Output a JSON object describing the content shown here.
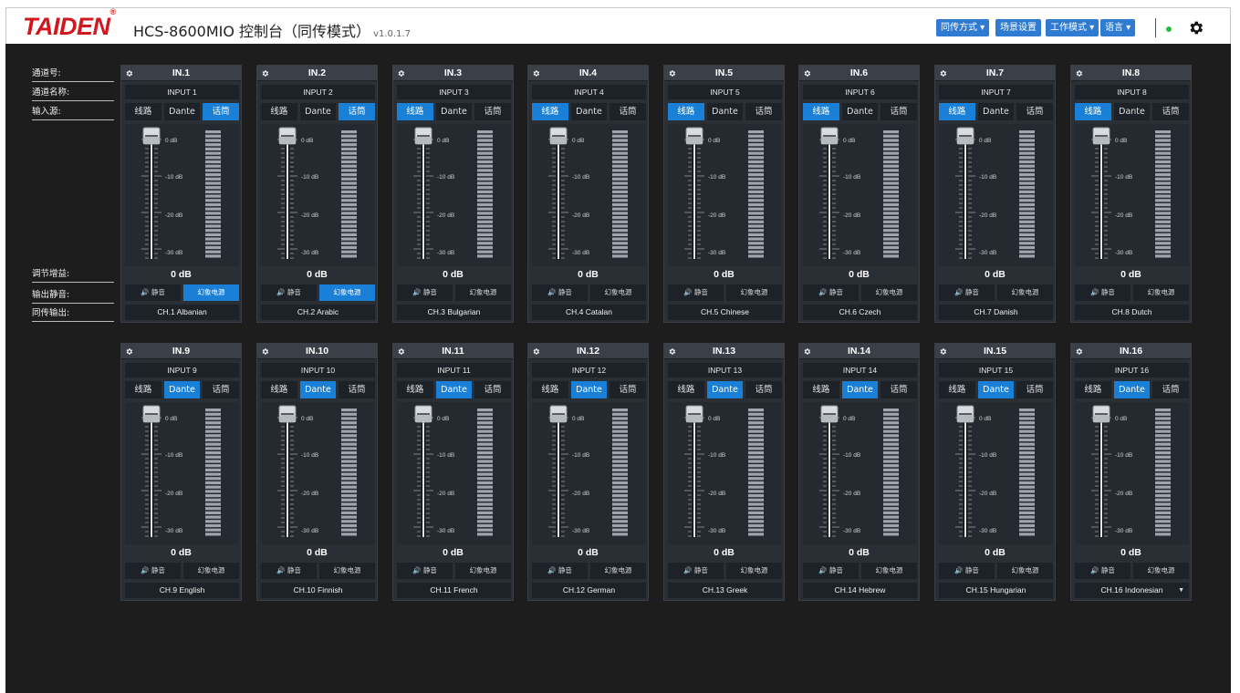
{
  "header": {
    "logo": "TAIDEN",
    "logo_mark": "®",
    "title": "HCS-8600MIO 控制台（同传模式）",
    "version": "v1.0.1.7",
    "menus": [
      "同传方式 ▾",
      "场景设置",
      "工作模式 ▾",
      "语言 ▾"
    ],
    "status_color": "#1fbf3c",
    "settings_icon": "gear-icon"
  },
  "row_labels": {
    "channel_num": "通道号:",
    "channel_name": "通道名称:",
    "input_source": "输入源:",
    "adjust_gain": "调节增益:",
    "output_mute": "输出静音:",
    "interp_output": "同传输出:"
  },
  "sources": [
    "线路",
    "Dante",
    "话筒"
  ],
  "mute_label": "🔊 静音",
  "phantom_label": "幻象电源",
  "scale": [
    "0 dB",
    "-10 dB",
    "-20 dB",
    "-30 dB"
  ],
  "accent_color": "#1a7fd6",
  "channels": [
    {
      "num": "IN.1",
      "name": "INPUT 1",
      "source": "话筒",
      "gain": "0 dB",
      "fader_level": 1.0,
      "mute": false,
      "phantom": true,
      "output": "CH.1 Albanian"
    },
    {
      "num": "IN.2",
      "name": "INPUT 2",
      "source": "话筒",
      "gain": "0 dB",
      "fader_level": 1.0,
      "mute": false,
      "phantom": true,
      "output": "CH.2 Arabic"
    },
    {
      "num": "IN.3",
      "name": "INPUT 3",
      "source": "线路",
      "gain": "0 dB",
      "fader_level": 1.0,
      "mute": false,
      "phantom": false,
      "output": "CH.3 Bulgarian"
    },
    {
      "num": "IN.4",
      "name": "INPUT 4",
      "source": "线路",
      "gain": "0 dB",
      "fader_level": 1.0,
      "mute": false,
      "phantom": false,
      "output": "CH.4 Catalan"
    },
    {
      "num": "IN.5",
      "name": "INPUT 5",
      "source": "线路",
      "gain": "0 dB",
      "fader_level": 1.0,
      "mute": false,
      "phantom": false,
      "output": "CH.5 Chinese"
    },
    {
      "num": "IN.6",
      "name": "INPUT 6",
      "source": "线路",
      "gain": "0 dB",
      "fader_level": 1.0,
      "mute": false,
      "phantom": false,
      "output": "CH.6 Czech"
    },
    {
      "num": "IN.7",
      "name": "INPUT 7",
      "source": "线路",
      "gain": "0 dB",
      "fader_level": 1.0,
      "mute": false,
      "phantom": false,
      "output": "CH.7 Danish"
    },
    {
      "num": "IN.8",
      "name": "INPUT 8",
      "source": "线路",
      "gain": "0 dB",
      "fader_level": 1.0,
      "mute": false,
      "phantom": false,
      "output": "CH.8 Dutch"
    },
    {
      "num": "IN.9",
      "name": "INPUT 9",
      "source": "Dante",
      "gain": "0 dB",
      "fader_level": 1.0,
      "mute": false,
      "phantom": false,
      "output": "CH.9 English"
    },
    {
      "num": "IN.10",
      "name": "INPUT 10",
      "source": "Dante",
      "gain": "0 dB",
      "fader_level": 1.0,
      "mute": false,
      "phantom": false,
      "output": "CH.10 Finnish"
    },
    {
      "num": "IN.11",
      "name": "INPUT 11",
      "source": "Dante",
      "gain": "0 dB",
      "fader_level": 1.0,
      "mute": false,
      "phantom": false,
      "output": "CH.11 French"
    },
    {
      "num": "IN.12",
      "name": "INPUT 12",
      "source": "Dante",
      "gain": "0 dB",
      "fader_level": 1.0,
      "mute": false,
      "phantom": false,
      "output": "CH.12 German"
    },
    {
      "num": "IN.13",
      "name": "INPUT 13",
      "source": "Dante",
      "gain": "0 dB",
      "fader_level": 1.0,
      "mute": false,
      "phantom": false,
      "output": "CH.13 Greek"
    },
    {
      "num": "IN.14",
      "name": "INPUT 14",
      "source": "Dante",
      "gain": "0 dB",
      "fader_level": 1.0,
      "mute": false,
      "phantom": false,
      "output": "CH.14 Hebrew"
    },
    {
      "num": "IN.15",
      "name": "INPUT 15",
      "source": "Dante",
      "gain": "0 dB",
      "fader_level": 1.0,
      "mute": false,
      "phantom": false,
      "output": "CH.15 Hungarian"
    },
    {
      "num": "IN.16",
      "name": "INPUT 16",
      "source": "Dante",
      "gain": "0 dB",
      "fader_level": 1.0,
      "mute": false,
      "phantom": false,
      "output": "CH.16 Indonesian",
      "output_dropdown": true
    }
  ]
}
